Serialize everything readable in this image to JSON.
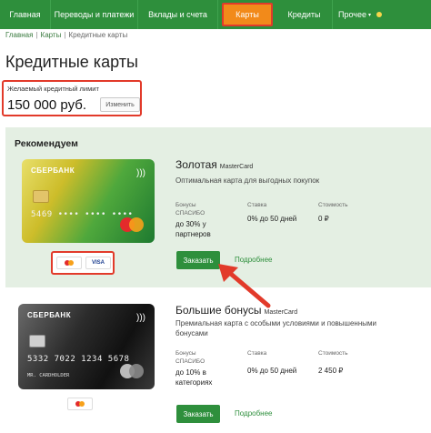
{
  "nav": {
    "items": [
      "Главная",
      "Переводы и платежи",
      "Вклады и счета",
      "Карты",
      "Кредиты",
      "Прочее"
    ]
  },
  "breadcrumb": [
    "Главная",
    "Карты",
    "Кредитные карты"
  ],
  "page_title": "Кредитные карты",
  "limit": {
    "label": "Желаемый кредитный лимит",
    "value": "150 000 руб.",
    "button": "Изменить"
  },
  "recommend": {
    "title": "Рекомендуем"
  },
  "cards": [
    {
      "name": "Золотая",
      "brand": "MasterCard",
      "description": "Оптимальная карта для выгодных покупок",
      "bonus_label": "Бонусы СПАСИБО",
      "bonus_value": "до 30% у партнеров",
      "rate_label": "Ставка",
      "rate_value": "0% до 50 дней",
      "cost_label": "Стоимость",
      "cost_value": "0 ₽",
      "order_button": "Заказать",
      "more_link": "Подробнее",
      "image_bank": "СБЕРБАНК",
      "image_number": "5469 •••• •••• ••••",
      "image_holder": ""
    },
    {
      "name": "Большие бонусы",
      "brand": "MasterCard",
      "description": "Премиальная карта с особыми условиями и повышенными бонусами",
      "bonus_label": "Бонусы СПАСИБО",
      "bonus_value": "до 10% в категориях",
      "rate_label": "Ставка",
      "rate_value": "0% до 50 дней",
      "cost_label": "Стоимость",
      "cost_value": "2 450 ₽",
      "order_button": "Заказать",
      "more_link": "Подробнее",
      "image_bank": "СБЕРБАНК",
      "image_number": "5332 7022 1234 5678",
      "image_holder": "MR. CARDHOLDER"
    }
  ],
  "pay_badges": [
    "VISA"
  ],
  "colors": {
    "brand_green": "#2e8f3c",
    "active_tab": "#f28a1a",
    "highlight_red": "#e23a2a",
    "recommend_bg": "#e4efe3"
  }
}
